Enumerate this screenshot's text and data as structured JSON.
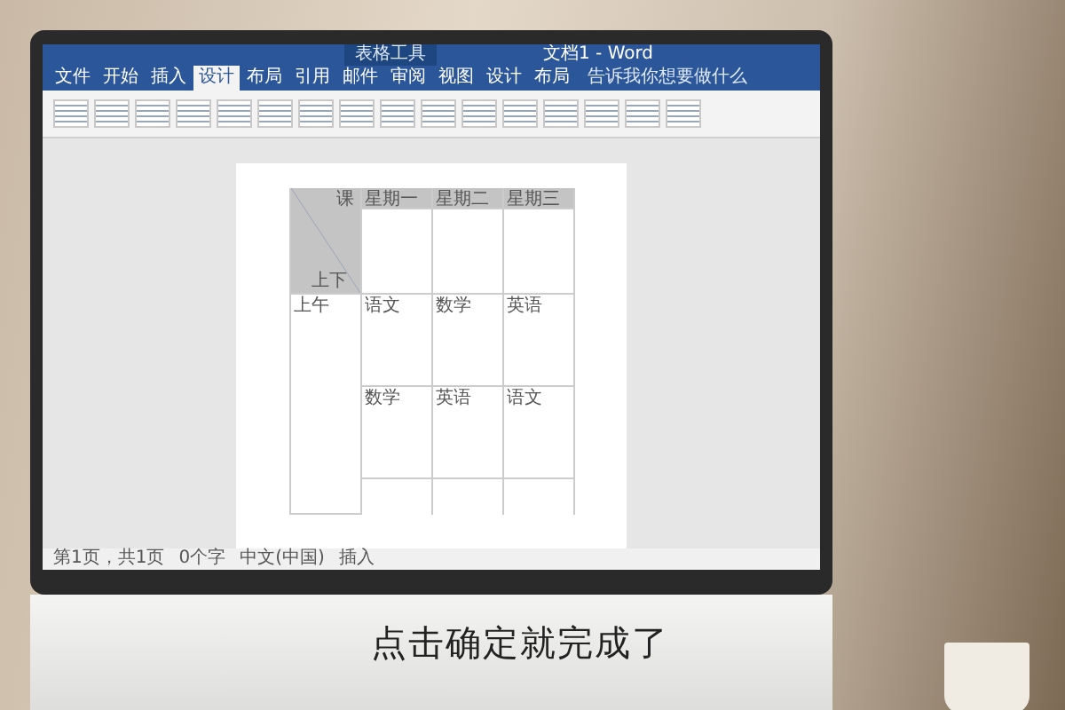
{
  "window": {
    "title": "文档1 - Word",
    "context_tab": "表格工具"
  },
  "tabs": [
    {
      "label": "文件",
      "selected": false
    },
    {
      "label": "开始",
      "selected": false
    },
    {
      "label": "插入",
      "selected": false
    },
    {
      "label": "设计",
      "selected": true
    },
    {
      "label": "布局",
      "selected": false
    },
    {
      "label": "引用",
      "selected": false
    },
    {
      "label": "邮件",
      "selected": false
    },
    {
      "label": "审阅",
      "selected": false
    },
    {
      "label": "视图",
      "selected": false
    },
    {
      "label": "设计",
      "selected": false
    },
    {
      "label": "布局",
      "selected": false
    }
  ],
  "tell_me": "告诉我你想要做什么",
  "table": {
    "corner": {
      "top": "课",
      "bottom": "上下"
    },
    "header": [
      "星期一",
      "星期二",
      "星期三"
    ],
    "rows": [
      {
        "label": "上午",
        "cells": [
          "语文",
          "数学",
          "英语"
        ]
      },
      {
        "cells": [
          "数学",
          "英语",
          "语文"
        ]
      }
    ]
  },
  "status_bar": [
    "第1页，共1页",
    "0个字",
    "中文(中国)",
    "插入"
  ],
  "subtitle": "点击确定就完成了"
}
